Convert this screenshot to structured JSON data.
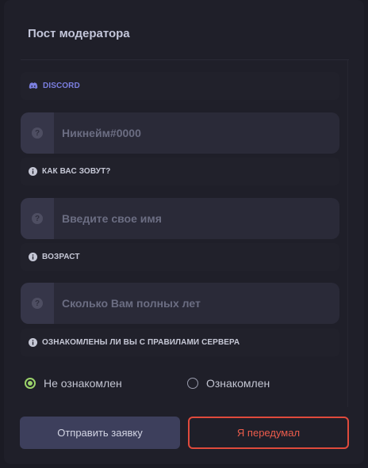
{
  "form": {
    "title": "Пост модератора",
    "discord_label": "DISCORD",
    "discord_placeholder": "Никнейм#0000",
    "name_label": "КАК ВАС ЗОВУТ?",
    "name_placeholder": "Введите свое имя",
    "age_label": "ВОЗРАСТ",
    "age_placeholder": "Сколько Вам полных лет",
    "rules_label": "ОЗНАКОМЛЕНЫ ЛИ ВЫ С ПРАВИЛАМИ СЕРВЕРА",
    "field_addon_icon": "question-icon",
    "radio_options": [
      {
        "label": "Не ознакомлен",
        "checked": true
      },
      {
        "label": "Ознакомлен",
        "checked": false
      }
    ],
    "submit_label": "Отправить заявку",
    "cancel_label": "Я передумал"
  },
  "colors": {
    "accent_green": "#9bd36a",
    "discord_blue": "#7b7fe0",
    "cancel_red": "#e04a3c"
  }
}
